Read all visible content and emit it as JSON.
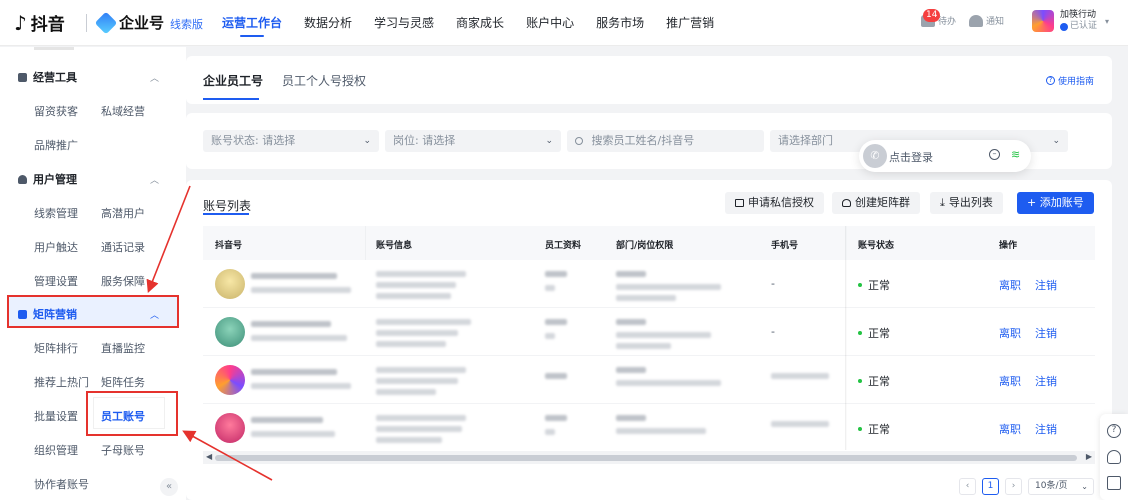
{
  "header": {
    "brand_douyin": "抖音",
    "brand_qiye": "企业号",
    "edition": "线索版",
    "nav": [
      "运营工作台",
      "数据分析",
      "学习与灵感",
      "商家成长",
      "账户中心",
      "服务市场",
      "推广营销"
    ],
    "todo_label": "待办",
    "todo_count": "14",
    "notice_label": "通知",
    "account_name": "加筷行动",
    "account_status": "已认证"
  },
  "sidebar": {
    "group_ops": "经营工具",
    "ops_items": [
      "留资获客",
      "私域经营",
      "品牌推广"
    ],
    "group_users": "用户管理",
    "users_items": [
      "线索管理",
      "高潜用户",
      "用户触达",
      "通话记录",
      "管理设置",
      "服务保障"
    ],
    "group_matrix": "矩阵营销",
    "matrix_items": [
      "矩阵排行",
      "直播监控",
      "推荐上热门",
      "矩阵任务",
      "批量设置",
      "员工账号",
      "组织管理",
      "子母账号",
      "协作者账号"
    ],
    "collapse": "«"
  },
  "tabs": {
    "items": [
      "企业员工号",
      "员工个人号授权"
    ],
    "guide": "使用指南"
  },
  "filters": {
    "status_label": "账号状态:",
    "status_value": "请选择",
    "post_label": "岗位:",
    "post_value": "请选择",
    "search_placeholder": "搜索员工姓名/抖音号",
    "dept_placeholder": "请选择部门"
  },
  "float_login": {
    "text": "点击登录"
  },
  "list": {
    "title": "账号列表",
    "btn_apply": "申请私信授权",
    "btn_create": "创建矩阵群",
    "btn_export": "导出列表",
    "btn_add": "+ 添加账号",
    "columns": [
      "抖音号",
      "账号信息",
      "员工资料",
      "部门/岗位权限",
      "手机号",
      "账号状态",
      "操作"
    ],
    "rows": [
      {
        "phone": "-",
        "status": "正常",
        "op1": "离职",
        "op2": "注销"
      },
      {
        "phone": "-",
        "status": "正常",
        "op1": "离职",
        "op2": "注销"
      },
      {
        "phone": "",
        "status": "正常",
        "op1": "离职",
        "op2": "注销"
      },
      {
        "phone": "",
        "status": "正常",
        "op1": "离职",
        "op2": "注销"
      }
    ]
  },
  "pagination": {
    "prev": "‹",
    "current": "1",
    "next": "›",
    "page_size": "10条/页"
  },
  "colors": {
    "accent": "#1e5cf0",
    "highlight_box": "#e5322d",
    "status_ok": "#23c343"
  },
  "icons": [
    "douyin-logo-icon",
    "cube-logo-icon",
    "todo-icon",
    "bell-icon",
    "chevron-up-icon",
    "question-icon",
    "headset-icon",
    "feedback-icon",
    "search-icon",
    "phone-icon",
    "wifi-icon"
  ]
}
